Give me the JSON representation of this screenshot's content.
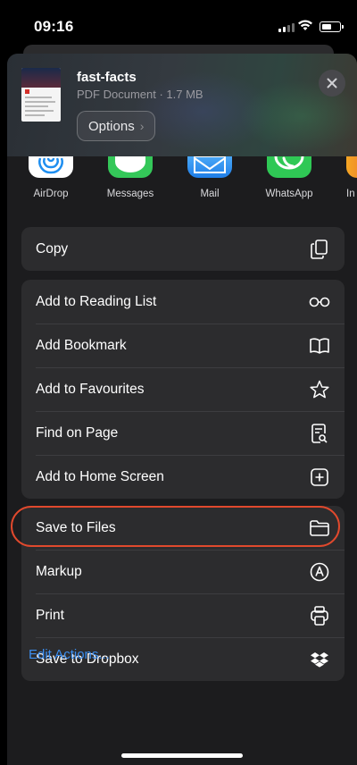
{
  "status": {
    "time": "09:16"
  },
  "share_header": {
    "doc_title": "fast-facts",
    "doc_subtitle": "PDF Document · 1.7 MB",
    "options_label": "Options",
    "options_chevron": "›"
  },
  "apps": [
    {
      "label": "AirDrop",
      "icon": "airdrop-icon",
      "color": "#1e8ef0"
    },
    {
      "label": "Messages",
      "icon": "messages-icon",
      "color": "#34c759"
    },
    {
      "label": "Mail",
      "icon": "mail-icon",
      "color": "#2a8cf2"
    },
    {
      "label": "WhatsApp",
      "icon": "whatsapp-icon",
      "color": "#2fc855"
    },
    {
      "label": "In",
      "icon": "instagram-icon",
      "color": "#e8543a"
    }
  ],
  "actions": {
    "copy": {
      "label": "Copy",
      "icon": "copy-icon"
    },
    "group1": [
      {
        "label": "Add to Reading List",
        "icon": "reading-glasses-icon"
      },
      {
        "label": "Add Bookmark",
        "icon": "book-icon"
      },
      {
        "label": "Add to Favourites",
        "icon": "star-icon"
      },
      {
        "label": "Find on Page",
        "icon": "find-on-page-icon"
      },
      {
        "label": "Add to Home Screen",
        "icon": "plus-square-icon"
      }
    ],
    "group2": [
      {
        "label": "Save to Files",
        "icon": "folder-icon",
        "highlighted": true
      },
      {
        "label": "Markup",
        "icon": "markup-icon"
      },
      {
        "label": "Print",
        "icon": "printer-icon"
      },
      {
        "label": "Save to Dropbox",
        "icon": "dropbox-icon"
      }
    ]
  },
  "edit_actions_label": "Edit Actions...",
  "colors": {
    "accent_link": "#3b8ef0",
    "highlight_ring": "#e0492d",
    "sheet_bg": "#1c1c1e",
    "row_bg": "#2c2c2e"
  }
}
